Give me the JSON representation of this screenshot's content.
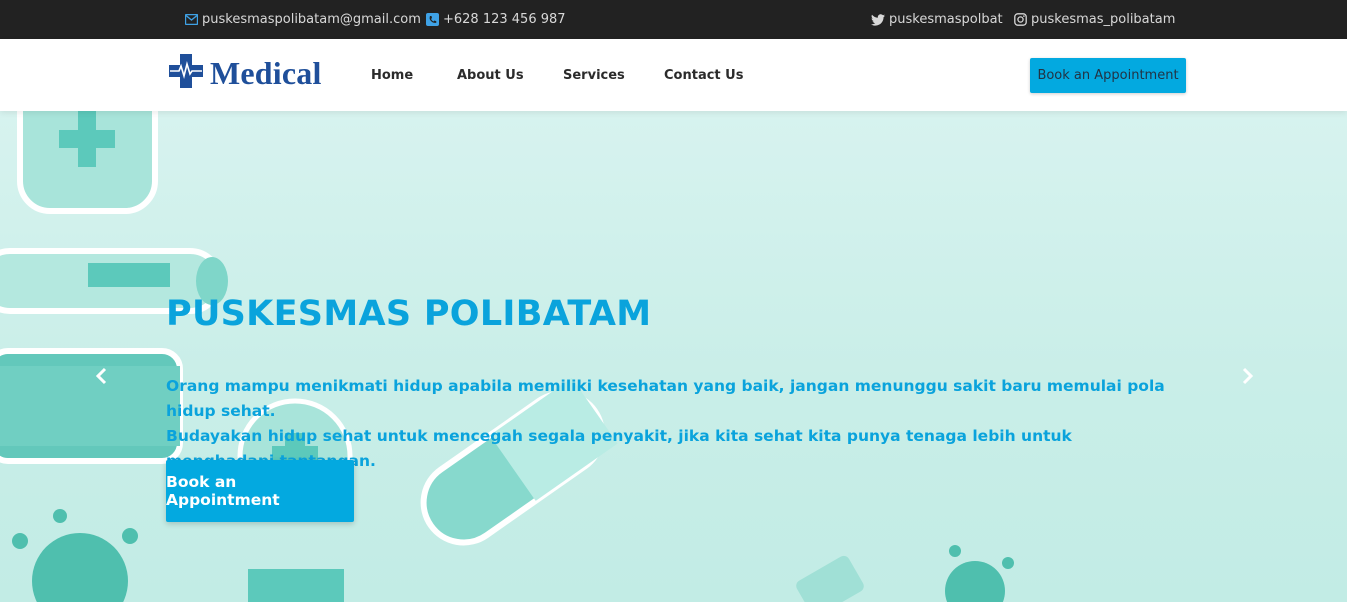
{
  "topbar": {
    "email": "puskesmaspolibatam@gmail.com",
    "phone": "+628 123 456 987",
    "twitter": "puskesmaspolbat",
    "instagram": "puskesmas_polibatam",
    "icons": {
      "email": "envelope-icon",
      "phone": "phone-icon",
      "twitter": "twitter-icon",
      "instagram": "instagram-icon"
    }
  },
  "navbar": {
    "logo_text": "Medical",
    "logo_icon": "medical-cross-icon",
    "links": [
      "Home",
      "About Us",
      "Services",
      "Contact Us"
    ],
    "cta_label": "Book an Appointment"
  },
  "hero": {
    "title": "PUSKESMAS POLIBATAM",
    "line1": "Orang mampu menikmati hidup apabila memiliki kesehatan yang baik, jangan menunggu sakit baru memulai pola hidup sehat.",
    "line2": "Budayakan hidup sehat untuk mencegah segala penyakit, jika kita sehat kita punya tenaga lebih untuk menghadapi tantangan.",
    "cta_label": "Book an Appointment",
    "prev_icon": "chevron-left-icon",
    "next_icon": "chevron-right-icon"
  },
  "colors": {
    "topbar_bg": "#222222",
    "accent": "#03a9e0",
    "title": "#0aa3dc",
    "logo": "#1f4f9a",
    "hero_bg": "#cfeeea"
  }
}
